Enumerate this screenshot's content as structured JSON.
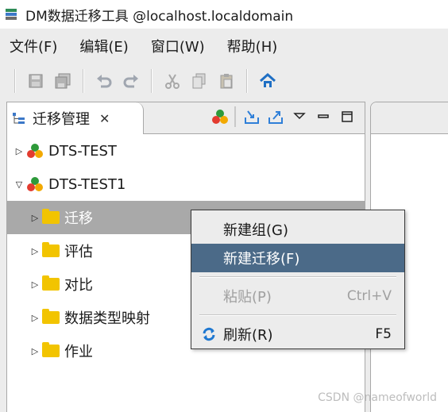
{
  "window": {
    "title": "DM数据迁移工具 @localhost.localdomain"
  },
  "menubar": {
    "items": [
      {
        "label": "文件(F)"
      },
      {
        "label": "编辑(E)"
      },
      {
        "label": "窗口(W)"
      },
      {
        "label": "帮助(H)"
      }
    ]
  },
  "view": {
    "tab_label": "迁移管理",
    "tab_close": "✕"
  },
  "tree": {
    "nodes": [
      {
        "label": "DTS-TEST",
        "expanded": false
      },
      {
        "label": "DTS-TEST1",
        "expanded": true
      },
      {
        "label": "迁移",
        "selected": true
      },
      {
        "label": "评估"
      },
      {
        "label": "对比"
      },
      {
        "label": "数据类型映射"
      },
      {
        "label": "作业"
      }
    ]
  },
  "context_menu": {
    "items": [
      {
        "label": "新建组(G)"
      },
      {
        "label": "新建迁移(F)",
        "active": true
      },
      {
        "label": "粘贴(P)",
        "accel": "Ctrl+V",
        "disabled": true
      },
      {
        "label": "刷新(R)",
        "accel": "F5"
      }
    ]
  },
  "watermark": "CSDN @nameofworld",
  "colors": {
    "selection": "#a9a9a9",
    "menu_active": "#4b6a88",
    "folder": "#f2c400",
    "refresh_icon": "#1f78d1"
  }
}
